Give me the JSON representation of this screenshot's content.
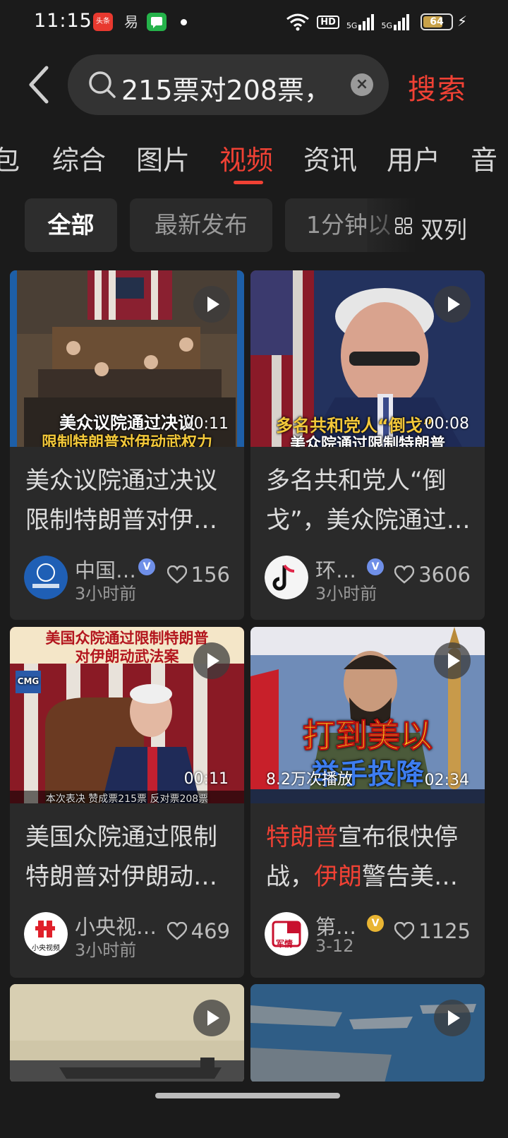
{
  "status_bar": {
    "time": "11:15",
    "app_icons": [
      "头条",
      "易",
      "消息"
    ],
    "hd_label": "HD",
    "signal_1": "5G",
    "signal_2": "5G",
    "battery": "64",
    "battery_level": 0.64
  },
  "search": {
    "query": "215票对208票，",
    "button_label": "搜索"
  },
  "tabs": [
    "包",
    "综合",
    "图片",
    "视频",
    "资讯",
    "用户",
    "音"
  ],
  "active_tab": "视频",
  "filters": [
    "全部",
    "最新发布",
    "1分钟以"
  ],
  "layout_toggle_label": "双列",
  "cards": [
    {
      "overlay_caption": "美众议院通过决议",
      "overlay_caption_2": "限制特朗普对伊动武权力",
      "duration": "00:11",
      "title": "美众议院通过决议限制特朗普对伊…",
      "author": "中国…",
      "verified": "V",
      "time": "3小时前",
      "likes": "156"
    },
    {
      "overlay_caption": "多名共和党人“倒戈”",
      "overlay_caption_2": "美众院通过限制特朗普",
      "duration": "00:08",
      "title": "多名共和党人“倒戈”，美众院通过…",
      "author": "环…",
      "verified": "V",
      "time": "3小时前",
      "likes": "3606"
    },
    {
      "overlay_caption": "美国众院通过限制特朗普",
      "overlay_caption_2": "对伊朗动武法案",
      "footer_caption": "本次表决 赞成票215票 反对票208票",
      "brand": "CMG",
      "duration": "00:11",
      "title": "美国众院通过限制特朗普对伊朗动…",
      "author": "小央视…",
      "avatar_label": "小央视频",
      "verified": "",
      "time": "3小时前",
      "likes": "469"
    },
    {
      "overlay_caption": "打到美以",
      "overlay_caption_2": "举手投降",
      "views": "8.2万次播放",
      "duration": "02:34",
      "title_part1": "特朗普",
      "title_part2": "宣布很快停战，",
      "title_part3": "伊朗",
      "title_part4": "警告美…",
      "author": "第…",
      "avatar_label": "军情",
      "verified": "V",
      "time": "3-12",
      "likes": "1125"
    }
  ],
  "colors": {
    "background": "#1b1b1b",
    "card": "#2a2a2a",
    "accent": "#f04134",
    "verified_blue": "#6f8fe8",
    "verified_gold": "#e9b533"
  }
}
